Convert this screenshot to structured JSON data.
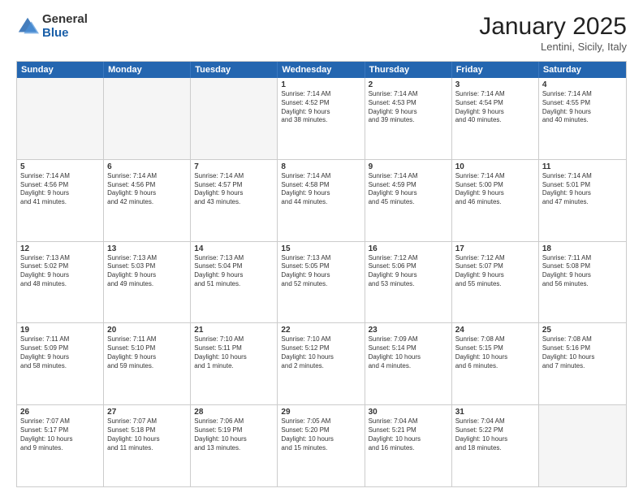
{
  "logo": {
    "general": "General",
    "blue": "Blue"
  },
  "header": {
    "month": "January 2025",
    "location": "Lentini, Sicily, Italy"
  },
  "weekdays": [
    "Sunday",
    "Monday",
    "Tuesday",
    "Wednesday",
    "Thursday",
    "Friday",
    "Saturday"
  ],
  "rows": [
    [
      {
        "day": "",
        "text": ""
      },
      {
        "day": "",
        "text": ""
      },
      {
        "day": "",
        "text": ""
      },
      {
        "day": "1",
        "text": "Sunrise: 7:14 AM\nSunset: 4:52 PM\nDaylight: 9 hours\nand 38 minutes."
      },
      {
        "day": "2",
        "text": "Sunrise: 7:14 AM\nSunset: 4:53 PM\nDaylight: 9 hours\nand 39 minutes."
      },
      {
        "day": "3",
        "text": "Sunrise: 7:14 AM\nSunset: 4:54 PM\nDaylight: 9 hours\nand 40 minutes."
      },
      {
        "day": "4",
        "text": "Sunrise: 7:14 AM\nSunset: 4:55 PM\nDaylight: 9 hours\nand 40 minutes."
      }
    ],
    [
      {
        "day": "5",
        "text": "Sunrise: 7:14 AM\nSunset: 4:56 PM\nDaylight: 9 hours\nand 41 minutes."
      },
      {
        "day": "6",
        "text": "Sunrise: 7:14 AM\nSunset: 4:56 PM\nDaylight: 9 hours\nand 42 minutes."
      },
      {
        "day": "7",
        "text": "Sunrise: 7:14 AM\nSunset: 4:57 PM\nDaylight: 9 hours\nand 43 minutes."
      },
      {
        "day": "8",
        "text": "Sunrise: 7:14 AM\nSunset: 4:58 PM\nDaylight: 9 hours\nand 44 minutes."
      },
      {
        "day": "9",
        "text": "Sunrise: 7:14 AM\nSunset: 4:59 PM\nDaylight: 9 hours\nand 45 minutes."
      },
      {
        "day": "10",
        "text": "Sunrise: 7:14 AM\nSunset: 5:00 PM\nDaylight: 9 hours\nand 46 minutes."
      },
      {
        "day": "11",
        "text": "Sunrise: 7:14 AM\nSunset: 5:01 PM\nDaylight: 9 hours\nand 47 minutes."
      }
    ],
    [
      {
        "day": "12",
        "text": "Sunrise: 7:13 AM\nSunset: 5:02 PM\nDaylight: 9 hours\nand 48 minutes."
      },
      {
        "day": "13",
        "text": "Sunrise: 7:13 AM\nSunset: 5:03 PM\nDaylight: 9 hours\nand 49 minutes."
      },
      {
        "day": "14",
        "text": "Sunrise: 7:13 AM\nSunset: 5:04 PM\nDaylight: 9 hours\nand 51 minutes."
      },
      {
        "day": "15",
        "text": "Sunrise: 7:13 AM\nSunset: 5:05 PM\nDaylight: 9 hours\nand 52 minutes."
      },
      {
        "day": "16",
        "text": "Sunrise: 7:12 AM\nSunset: 5:06 PM\nDaylight: 9 hours\nand 53 minutes."
      },
      {
        "day": "17",
        "text": "Sunrise: 7:12 AM\nSunset: 5:07 PM\nDaylight: 9 hours\nand 55 minutes."
      },
      {
        "day": "18",
        "text": "Sunrise: 7:11 AM\nSunset: 5:08 PM\nDaylight: 9 hours\nand 56 minutes."
      }
    ],
    [
      {
        "day": "19",
        "text": "Sunrise: 7:11 AM\nSunset: 5:09 PM\nDaylight: 9 hours\nand 58 minutes."
      },
      {
        "day": "20",
        "text": "Sunrise: 7:11 AM\nSunset: 5:10 PM\nDaylight: 9 hours\nand 59 minutes."
      },
      {
        "day": "21",
        "text": "Sunrise: 7:10 AM\nSunset: 5:11 PM\nDaylight: 10 hours\nand 1 minute."
      },
      {
        "day": "22",
        "text": "Sunrise: 7:10 AM\nSunset: 5:12 PM\nDaylight: 10 hours\nand 2 minutes."
      },
      {
        "day": "23",
        "text": "Sunrise: 7:09 AM\nSunset: 5:14 PM\nDaylight: 10 hours\nand 4 minutes."
      },
      {
        "day": "24",
        "text": "Sunrise: 7:08 AM\nSunset: 5:15 PM\nDaylight: 10 hours\nand 6 minutes."
      },
      {
        "day": "25",
        "text": "Sunrise: 7:08 AM\nSunset: 5:16 PM\nDaylight: 10 hours\nand 7 minutes."
      }
    ],
    [
      {
        "day": "26",
        "text": "Sunrise: 7:07 AM\nSunset: 5:17 PM\nDaylight: 10 hours\nand 9 minutes."
      },
      {
        "day": "27",
        "text": "Sunrise: 7:07 AM\nSunset: 5:18 PM\nDaylight: 10 hours\nand 11 minutes."
      },
      {
        "day": "28",
        "text": "Sunrise: 7:06 AM\nSunset: 5:19 PM\nDaylight: 10 hours\nand 13 minutes."
      },
      {
        "day": "29",
        "text": "Sunrise: 7:05 AM\nSunset: 5:20 PM\nDaylight: 10 hours\nand 15 minutes."
      },
      {
        "day": "30",
        "text": "Sunrise: 7:04 AM\nSunset: 5:21 PM\nDaylight: 10 hours\nand 16 minutes."
      },
      {
        "day": "31",
        "text": "Sunrise: 7:04 AM\nSunset: 5:22 PM\nDaylight: 10 hours\nand 18 minutes."
      },
      {
        "day": "",
        "text": ""
      }
    ]
  ]
}
